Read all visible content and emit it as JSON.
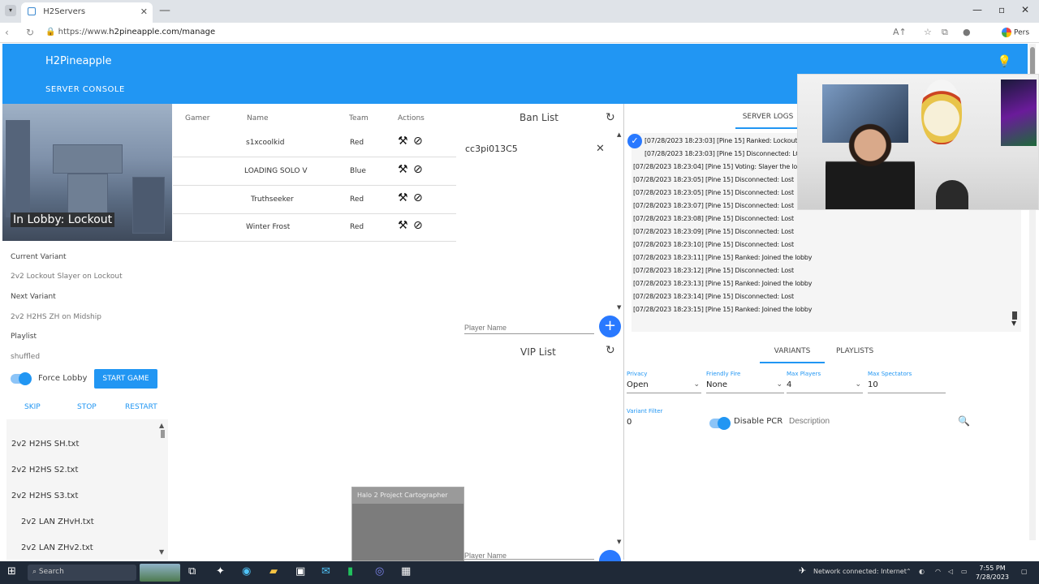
{
  "browser": {
    "tab_title": "H2Servers",
    "url_prefix": "https://www.",
    "url_host": "h2pineapple.com/manage",
    "profile_label": "Pers"
  },
  "app": {
    "title": "H2Pineapple",
    "server_tab": "SERVER CONSOLE"
  },
  "server": {
    "map_caption": "In Lobby: Lockout",
    "current_variant_label": "Current Variant",
    "current_variant_value": "2v2 Lockout Slayer on Lockout",
    "next_variant_label": "Next Variant",
    "next_variant_value": "2v2 H2HS ZH on Midship",
    "playlist_label": "Playlist",
    "playlist_value": "shuffled",
    "force_lobby_label": "Force Lobby",
    "start_game": "START GAME",
    "skip": "SKIP",
    "stop": "STOP",
    "restart": "RESTART"
  },
  "playlist_items": [
    "2v2 H2HS SH.txt",
    "2v2 H2HS S2.txt",
    "2v2 H2HS S3.txt",
    "2v2 LAN ZHvH.txt",
    "2v2 LAN ZHv2.txt"
  ],
  "players": {
    "headers": [
      "Gamer",
      "Name",
      "Team",
      "Actions"
    ],
    "rows": [
      {
        "name": "s1xcoolkid",
        "team": "Red"
      },
      {
        "name": "LOADING SOLO V",
        "team": "Blue"
      },
      {
        "name": "Truthseeker",
        "team": "Red"
      },
      {
        "name": "Winter Frost",
        "team": "Red"
      }
    ]
  },
  "ban_list": {
    "title": "Ban List",
    "items": [
      "cc3pi013C5"
    ],
    "input_placeholder": "Player Name",
    "add": "+"
  },
  "vip_list": {
    "title": "VIP List",
    "input_placeholder": "Player Name",
    "add": "+"
  },
  "console": {
    "tab_active": "SERVER LOGS",
    "lines": [
      "[07/28/2023 18:23:03] [Pine 15] Ranked: Lockout Slayer the lobby",
      "[07/28/2023 18:23:03] [Pine 15] Disconnected: LOST SOLO V",
      "[07/28/2023 18:23:04] [Pine 15] Voting: Slayer the lobby",
      "[07/28/2023 18:23:05] [Pine 15] Disconnected: Lost",
      "[07/28/2023 18:23:05] [Pine 15] Disconnected: Lost",
      "[07/28/2023 18:23:07] [Pine 15] Disconnected: Lost",
      "[07/28/2023 18:23:08] [Pine 15] Disconnected: Lost",
      "[07/28/2023 18:23:09] [Pine 15] Disconnected: Lost",
      "[07/28/2023 18:23:10] [Pine 15] Disconnected: Lost",
      "[07/28/2023 18:23:11] [Pine 15] Ranked: Joined the lobby",
      "[07/28/2023 18:23:12] [Pine 15] Disconnected: Lost",
      "[07/28/2023 18:23:13] [Pine 15] Ranked: Joined the lobby",
      "[07/28/2023 18:23:14] [Pine 15] Disconnected: Lost",
      "[07/28/2023 18:23:15] [Pine 15] Ranked: Joined the lobby"
    ],
    "settings_tabs": [
      "VARIANTS",
      "PLAYLISTS"
    ],
    "fields": [
      {
        "label": "Privacy",
        "value": "Open"
      },
      {
        "label": "Friendly Fire",
        "value": "None"
      },
      {
        "label": "Max Players",
        "value": "4"
      },
      {
        "label": "Max Spectators",
        "value": "10"
      }
    ],
    "filter_label": "Variant Filter",
    "filter_value": "0",
    "disable_pcr": "Disable PCR",
    "description_placeholder": "Description"
  },
  "floating_window": {
    "title": "Halo 2 Project Cartographer"
  },
  "taskbar": {
    "search": "Search",
    "tray_text": "Network connected: Internet",
    "time": "7:55 PM",
    "date": "7/28/2023"
  },
  "colors": {
    "accent": "#2196f3",
    "fab": "#2979ff",
    "taskbar": "#1f2937"
  }
}
